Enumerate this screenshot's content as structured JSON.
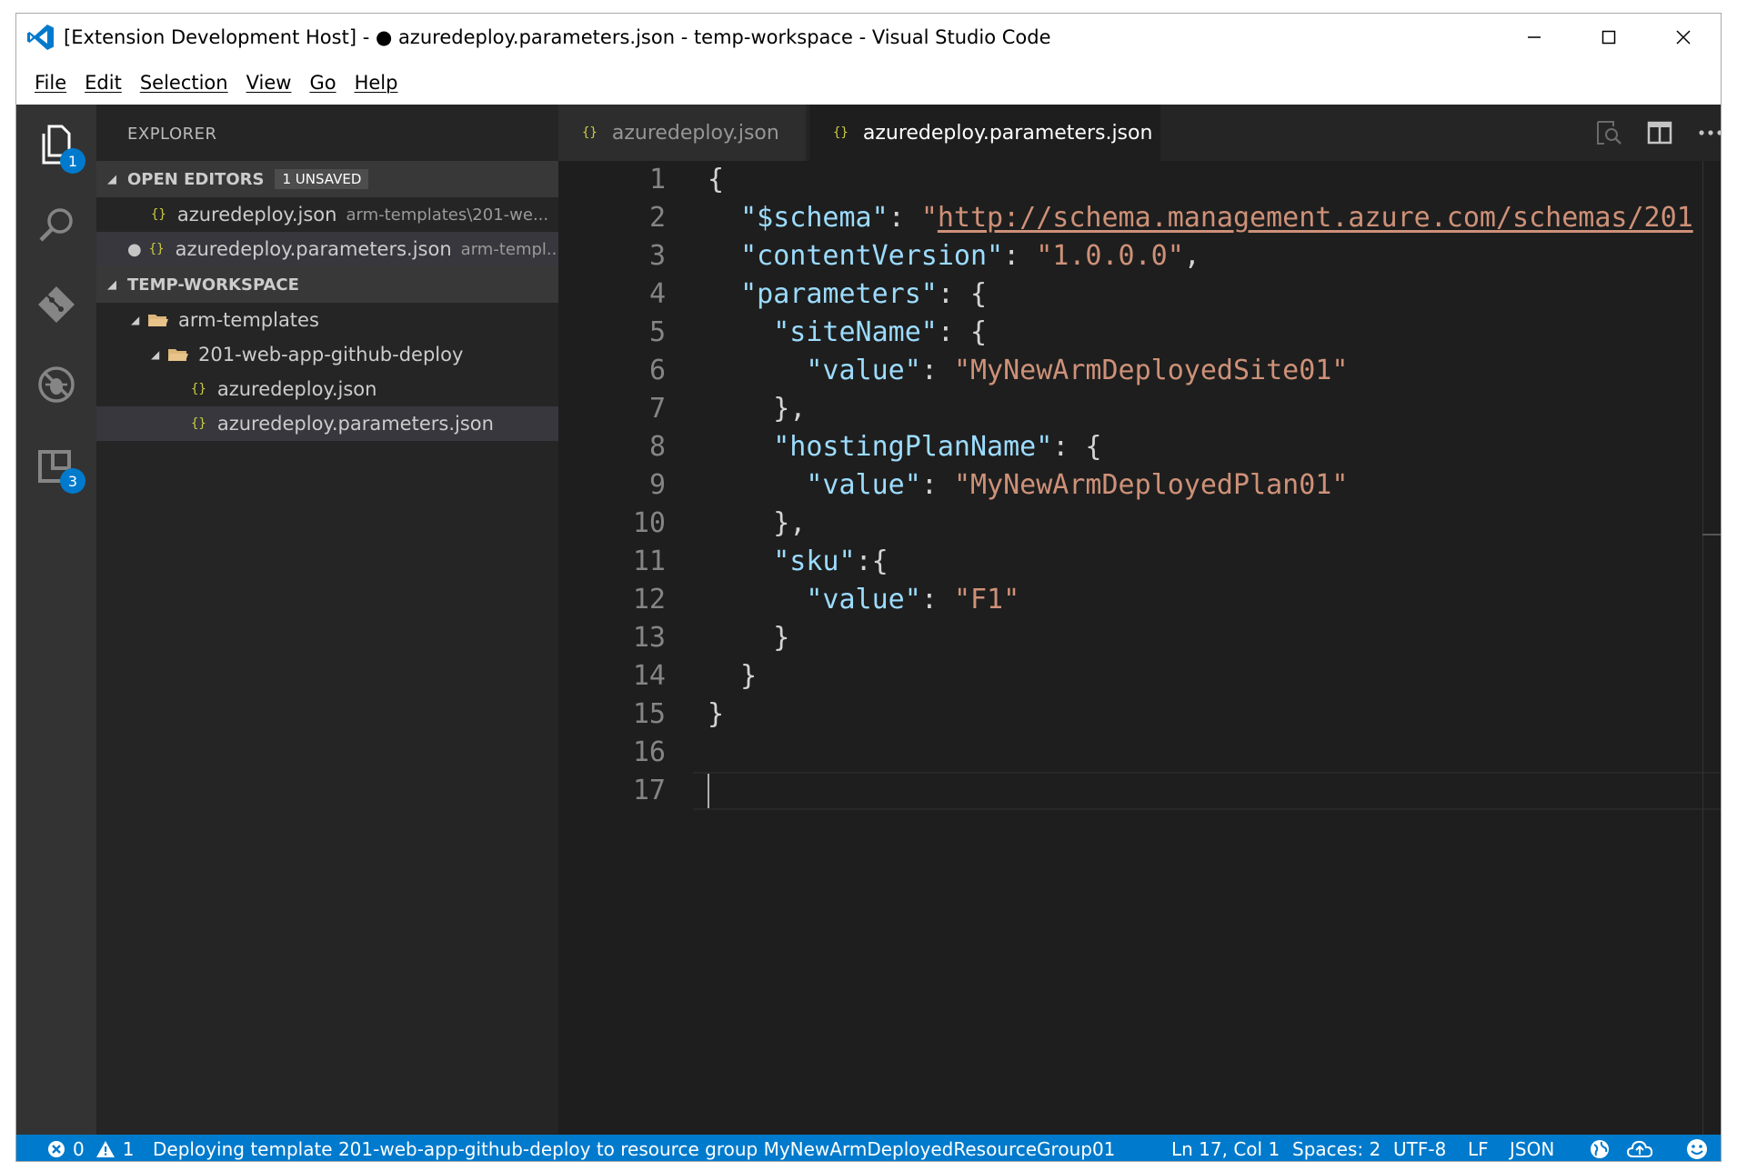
{
  "window": {
    "title": "[Extension Development Host] - ● azuredeploy.parameters.json - temp-workspace - Visual Studio Code",
    "controls": [
      "minimize",
      "maximize",
      "close"
    ]
  },
  "menu": [
    "File",
    "Edit",
    "Selection",
    "View",
    "Go",
    "Help"
  ],
  "activity_bar": {
    "items": [
      {
        "icon": "files-icon",
        "badge": "1"
      },
      {
        "icon": "search-icon",
        "badge": null
      },
      {
        "icon": "source-control-icon",
        "badge": null
      },
      {
        "icon": "debug-icon",
        "badge": null
      },
      {
        "icon": "extensions-icon",
        "badge": "3"
      }
    ]
  },
  "sidebar": {
    "title": "EXPLORER",
    "open_editors": {
      "header": "OPEN EDITORS",
      "badge": "1 UNSAVED",
      "items": [
        {
          "name": "azuredeploy.json",
          "path": "arm-templates\\201-we...",
          "modified": false
        },
        {
          "name": "azuredeploy.parameters.json",
          "path": "arm-templ...",
          "modified": true
        }
      ]
    },
    "workspace": {
      "header": "TEMP-WORKSPACE",
      "tree": [
        {
          "name": "arm-templates",
          "type": "folder"
        },
        {
          "name": "201-web-app-github-deploy",
          "type": "folder"
        },
        {
          "name": "azuredeploy.json",
          "type": "file"
        },
        {
          "name": "azuredeploy.parameters.json",
          "type": "file"
        }
      ]
    }
  },
  "tabs": [
    {
      "label": "azuredeploy.json",
      "active": false
    },
    {
      "label": "azuredeploy.parameters.json",
      "active": true,
      "dirty": true
    }
  ],
  "editor": {
    "language_icon": "{}",
    "lines": [
      "{",
      "  \"$schema\": \"http://schema.management.azure.com/schemas/201",
      "  \"contentVersion\": \"1.0.0.0\",",
      "  \"parameters\": {",
      "    \"siteName\": {",
      "      \"value\": \"MyNewArmDeployedSite01\"",
      "    },",
      "    \"hostingPlanName\": {",
      "      \"value\": \"MyNewArmDeployedPlan01\"",
      "    },",
      "    \"sku\":{",
      "      \"value\": \"F1\"",
      "    }",
      "  }",
      "}",
      "",
      ""
    ],
    "current_line": 17
  },
  "status_bar": {
    "errors": "0",
    "warnings": "1",
    "message": "Deploying template 201-web-app-github-deploy to resource group MyNewArmDeployedResourceGroup01",
    "position": "Ln 17, Col 1",
    "spaces": "Spaces: 2",
    "encoding": "UTF-8",
    "eol": "LF",
    "language": "JSON"
  },
  "colors": {
    "accent": "#007acc",
    "key": "#9cdcfe",
    "string": "#ce9178",
    "json_icon": "#cbcb41"
  }
}
